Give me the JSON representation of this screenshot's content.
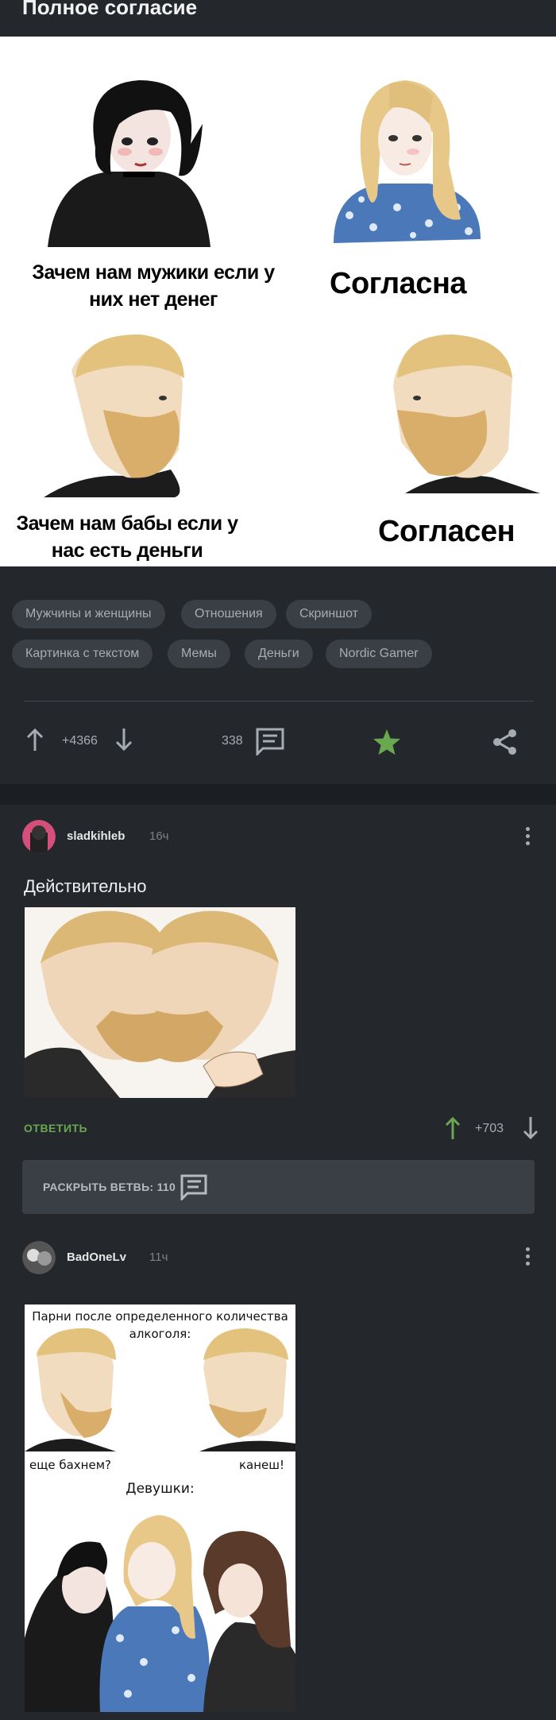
{
  "post": {
    "title": "Полное согласие",
    "captions": {
      "top_left": "Зачем нам мужики если у них нет денег",
      "top_right": "Согласна",
      "bottom_left": "Зачем нам бабы если у нас есть деньги",
      "bottom_right": "Согласен"
    },
    "tags": [
      "Мужчины и женщины",
      "Отношения",
      "Скриншот",
      "Картинка с текстом",
      "Мемы",
      "Деньги",
      "Nordic Gamer"
    ],
    "rating": "+4366",
    "comments_count": "338"
  },
  "comments": [
    {
      "author": "sladkihleb",
      "time": "16ч",
      "text": "Действительно",
      "reply_label": "ОТВЕТИТЬ",
      "rating": "+703",
      "expand_label": "РАСКРЫТЬ ВЕТВЬ: 110"
    },
    {
      "author": "BadOneLv",
      "time": "11ч",
      "meme": {
        "header": "Парни после определенного количества алкоголя:",
        "left_text": "еще бахнем?",
        "right_text": "канеш!",
        "bottom_header": "Девушки:"
      }
    }
  ],
  "colors": {
    "background": "#24282d",
    "tag_bg": "#3a3f45",
    "accent_green": "#6aa84f",
    "star": "#6aa84f"
  },
  "icons": [
    "arrow-up-icon",
    "arrow-down-icon",
    "comment-icon",
    "star-icon",
    "share-icon",
    "kebab-icon"
  ]
}
